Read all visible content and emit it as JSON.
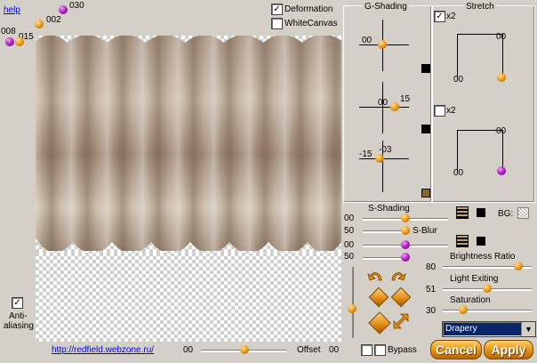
{
  "top": {
    "help_link": "help",
    "deformation_label": "Deformation",
    "deformation_checked": "✓",
    "whitecanvas_label": "WhiteCanvas",
    "val_030": "030",
    "val_002": "002",
    "val_008": "008",
    "val_015": "015"
  },
  "gshading": {
    "title": "G-Shading",
    "row1_left": "00",
    "row2_left": "00",
    "row2_right": "15",
    "row3_left": "-15",
    "row3_right": "-03"
  },
  "stretch": {
    "title": "Stretch",
    "x2_top": "x2",
    "x2_top_checked": "✓",
    "x2_bottom": "x2",
    "top_val_right": "00",
    "top_val_left": "00",
    "bottom_val_right": "00",
    "bottom_val_left": "00"
  },
  "sshading": {
    "title": "S-Shading",
    "row1_val": "00",
    "row2_val": "50",
    "sblur_label": "S-Blur",
    "row3_val": "00",
    "row4_val": "50",
    "bg_label": "BG:"
  },
  "adjust": {
    "brightness_label": "Brightness Ratio",
    "brightness_val": "80",
    "light_label": "Light Exiting",
    "light_val": "51",
    "saturation_label": "Saturation",
    "saturation_val": "30"
  },
  "bottom": {
    "antialias_label_1": "Anti-",
    "antialias_label_2": "aliasing",
    "antialias_checked": "✓",
    "url": "http://redfield.webzone.ru/",
    "offset_left_val": "00",
    "offset_label": "Offset",
    "offset_right_val": "00",
    "bypass_label": "Bypass",
    "preset_selected": "Drapery",
    "cancel_label": "Cancel",
    "apply_label": "Apply"
  },
  "colors": {
    "background": "#d4d0c8",
    "accent_orange": "#f0a020",
    "accent_purple": "#b020c0",
    "selection_blue": "#0a246a"
  }
}
